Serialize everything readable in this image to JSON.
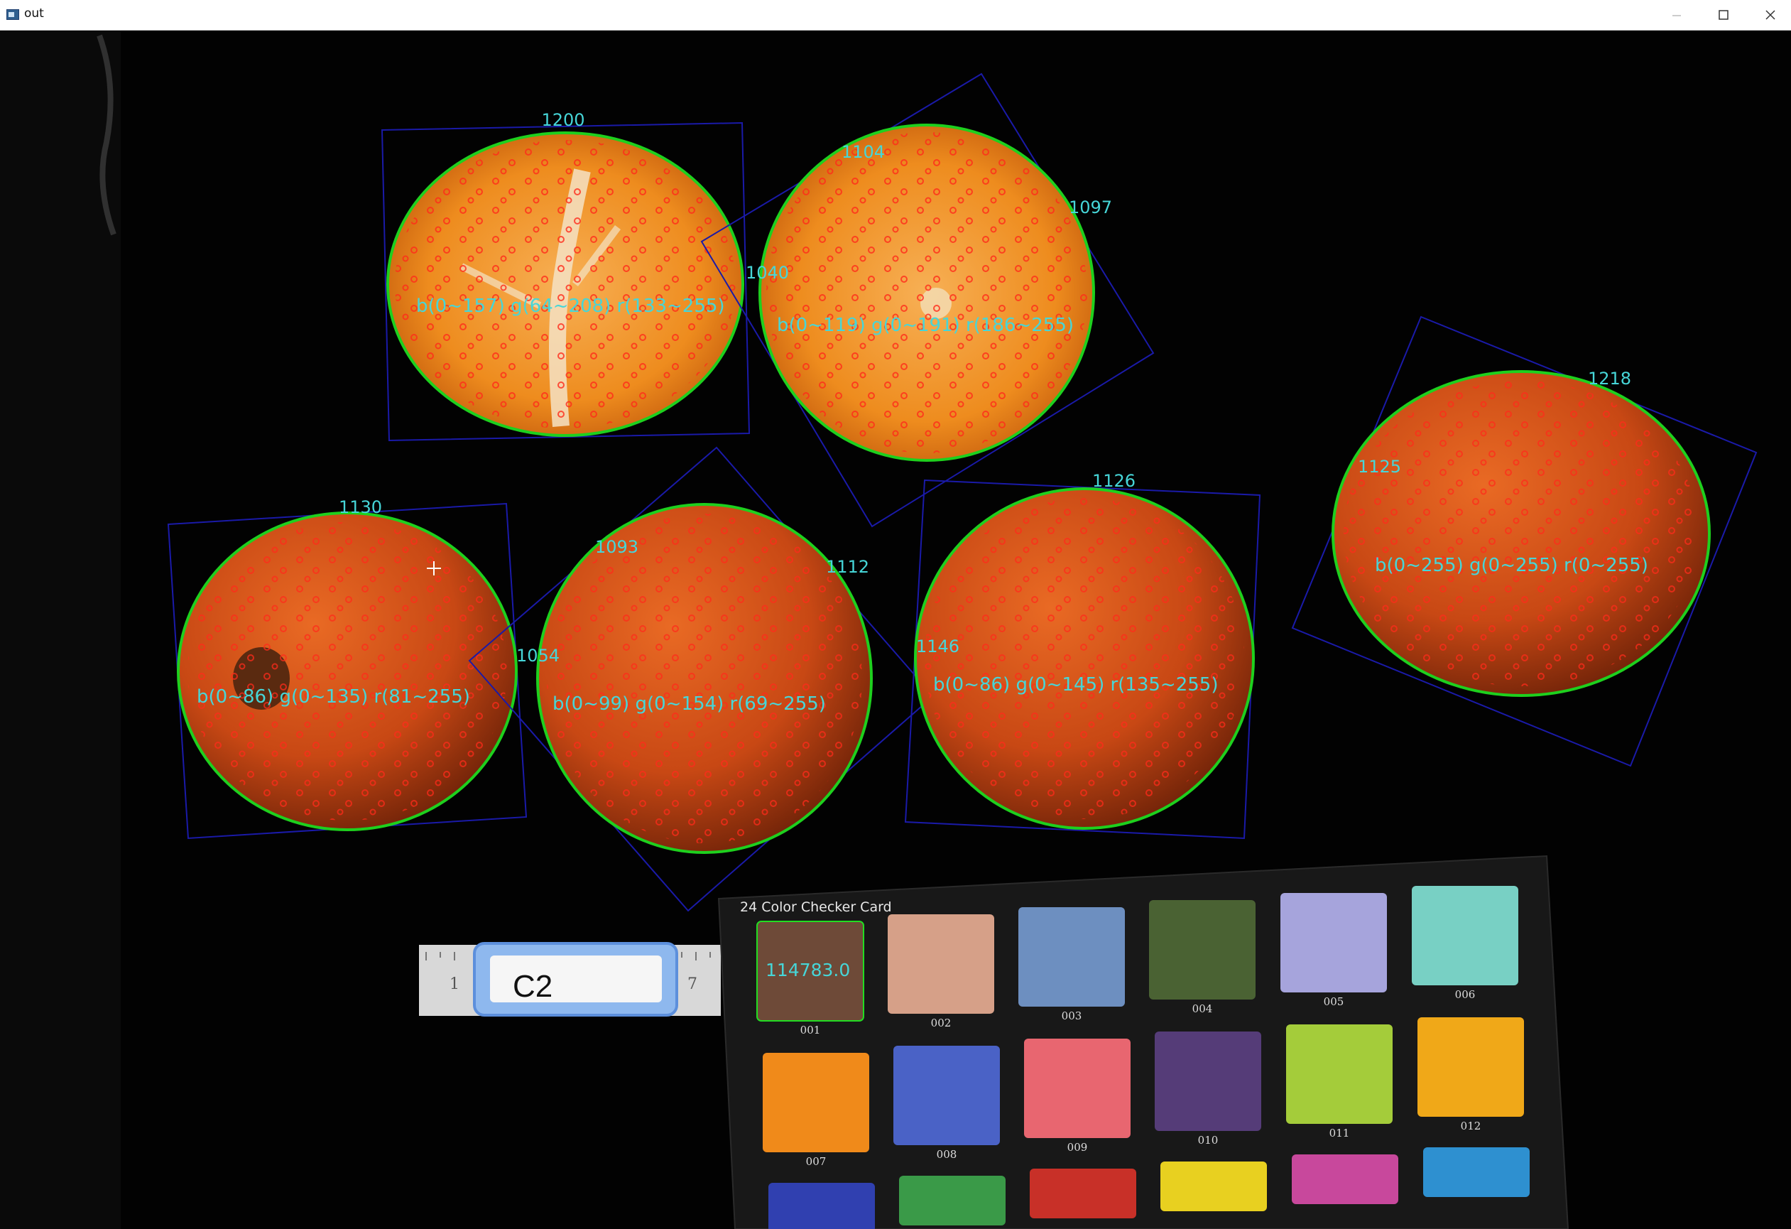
{
  "window": {
    "title": "out"
  },
  "labels": {
    "counts": [
      "1200",
      "1104",
      "1097",
      "1040",
      "1218",
      "1125",
      "1130",
      "1093",
      "1112",
      "1054",
      "1126",
      "1146"
    ],
    "ranges": [
      "b(0~157) g(64~208) r(133~255)",
      "b(0~119) g(0~191) r(186~255)",
      "b(0~255) g(0~255) r(0~255)",
      "b(0~86) g(0~135) r(81~255)",
      "b(0~99) g(0~154) r(69~255)",
      "b(0~86) g(0~145) r(135~255)"
    ]
  },
  "ruler": {
    "left_num": "1",
    "right_num": "7",
    "tag": "C2"
  },
  "card": {
    "title": "24 Color Checker Card",
    "first_value": "114783.0",
    "patches": [
      {
        "num": "001",
        "color": "#6e4a38"
      },
      {
        "num": "002",
        "color": "#d6a088"
      },
      {
        "num": "003",
        "color": "#6d8fc0"
      },
      {
        "num": "004",
        "color": "#4a6233"
      },
      {
        "num": "005",
        "color": "#a6a4dc"
      },
      {
        "num": "006",
        "color": "#78d0c4"
      },
      {
        "num": "007",
        "color": "#f08a1a"
      },
      {
        "num": "008",
        "color": "#4a62c6"
      },
      {
        "num": "009",
        "color": "#e86670"
      },
      {
        "num": "010",
        "color": "#553c78"
      },
      {
        "num": "011",
        "color": "#a4cc3a"
      },
      {
        "num": "012",
        "color": "#f0a818"
      },
      {
        "num": "",
        "color": "#3040b0"
      },
      {
        "num": "",
        "color": "#3a9a48"
      },
      {
        "num": "",
        "color": "#c83028"
      },
      {
        "num": "",
        "color": "#e8d020"
      },
      {
        "num": "",
        "color": "#c8489c"
      },
      {
        "num": "",
        "color": "#2e90d0"
      }
    ]
  }
}
